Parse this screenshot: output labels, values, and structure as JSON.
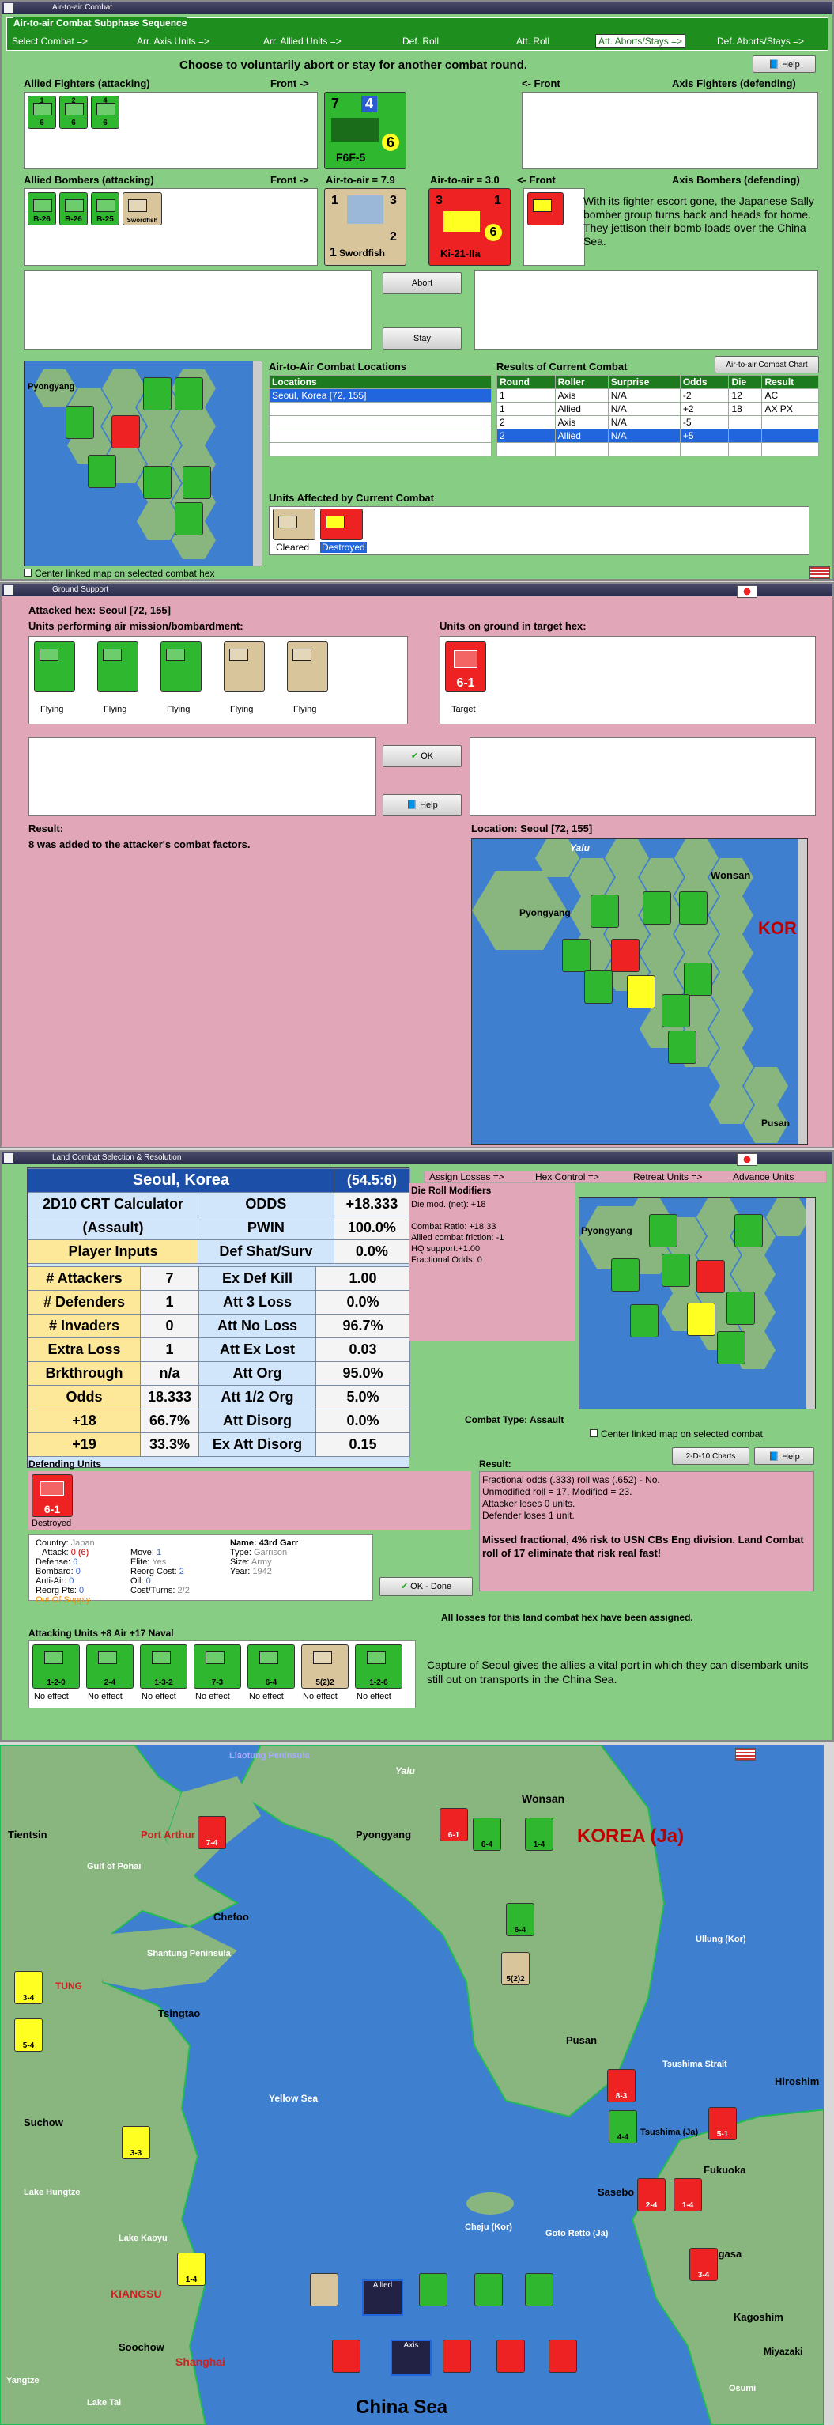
{
  "air": {
    "title": "Air-to-air Combat",
    "subphase": "Air-to-air Combat Subphase Sequence",
    "steps": [
      "Select Combat =>",
      "Arr. Axis Units =>",
      "Arr. Allied Units =>",
      "Def. Roll",
      "Att. Roll",
      "Att. Aborts/Stays =>",
      "Def. Aborts/Stays =>"
    ],
    "instruction": "Choose to voluntarily abort or stay for another combat round.",
    "help": "Help",
    "allied_fighters": "Allied Fighters (attacking)",
    "front": "Front ->",
    "front_back": "<- Front",
    "axis_fighters": "Axis Fighters (defending)",
    "allied_bombers": "Allied Bombers (attacking)",
    "axis_bombers": "Axis Bombers (defending)",
    "ata_allied": "Air-to-air = 7.9",
    "ata_axis": "Air-to-air = 3.0",
    "message": "With its fighter escort gone, the Japanese Sally bomber group turns back and heads for home.  They jettison their bomb loads over the China Sea.",
    "abort": "Abort",
    "stay": "Stay",
    "locations_title": "Air-to-Air Combat Locations",
    "locations_header": "Locations",
    "locations": [
      "Seoul, Korea [72, 155]"
    ],
    "results_title": "Results of Current Combat",
    "chart_btn": "Air-to-air Combat Chart",
    "results_headers": [
      "Round",
      "Roller",
      "Surprise",
      "Odds",
      "Die",
      "Result"
    ],
    "results": [
      [
        "1",
        "Axis",
        "N/A",
        "-2",
        "12",
        "AC"
      ],
      [
        "1",
        "Allied",
        "N/A",
        "+2",
        "18",
        "AX PX"
      ],
      [
        "2",
        "Axis",
        "N/A",
        "-5",
        "",
        ""
      ],
      [
        "2",
        "Allied",
        "N/A",
        "+5",
        "",
        ""
      ]
    ],
    "affected_title": "Units Affected by Current Combat",
    "affected": [
      "Cleared",
      "Destroyed"
    ],
    "center_map": "Center linked map on selected combat hex",
    "fighters": [
      {
        "n": "1",
        "v": "6"
      },
      {
        "n": "2",
        "v": "6"
      },
      {
        "n": "4",
        "v": "6"
      }
    ],
    "big_f": {
      "top": "7",
      "mid": "4",
      "bot": "6",
      "name": "F6F-5"
    },
    "bombers_lbl": [
      "B-26",
      "B-26",
      "B-25",
      "Swordfish"
    ],
    "big_b": {
      "a": "1",
      "b": "3",
      "name": "Swordfish",
      "c": "1",
      "d": "2"
    },
    "big_axis": {
      "a": "3",
      "b": "1",
      "v": "6",
      "name": "Ki-21-IIa"
    }
  },
  "ground": {
    "title": "Ground Support",
    "attacked": "Attacked hex: Seoul  [72, 155]",
    "performing": "Units performing air mission/bombardment:",
    "on_ground": "Units on ground in target hex:",
    "statuses": [
      "Flying",
      "Flying",
      "Flying",
      "Flying",
      "Flying"
    ],
    "target": "Target",
    "target_val": "6-1",
    "ok": "OK",
    "help": "Help",
    "result_lbl": "Result:",
    "result": "8 was added to the attacker's combat factors.",
    "location": "Location:  Seoul  [72, 155]",
    "map_labels": [
      "Yalu",
      "Wonsan",
      "Pyongyang",
      "KOR",
      "Pusan"
    ]
  },
  "land": {
    "title": "Land Combat Selection & Resolution",
    "steps": [
      "Assign Losses =>",
      "Hex Control =>",
      "Retreat Units =>",
      "Advance Units"
    ],
    "crt": {
      "location": "Seoul, Korea",
      "ratio": "(54.5:6)",
      "calc": "2D10 CRT Calculator",
      "assault": "(Assault)",
      "rows": [
        [
          "",
          "ODDS",
          "+18.333"
        ],
        [
          "",
          "PWIN",
          "100.0%"
        ],
        [
          "Player Inputs",
          "Def Shat/Surv",
          "0.0%"
        ],
        [
          "# Attackers",
          "7",
          "Ex Def Kill",
          "1.00"
        ],
        [
          "# Defenders",
          "1",
          "Att 3 Loss",
          "0.0%"
        ],
        [
          "# Invaders",
          "0",
          "Att No Loss",
          "96.7%"
        ],
        [
          "Extra Loss",
          "1",
          "Att Ex Lost",
          "0.03"
        ],
        [
          "Brkthrough",
          "n/a",
          "Att Org",
          "95.0%"
        ],
        [
          "Odds",
          "18.333",
          "Att 1/2 Org",
          "5.0%"
        ],
        [
          "+18",
          "66.7%",
          "Att Disorg",
          "0.0%"
        ],
        [
          "+19",
          "33.3%",
          "Ex Att Disorg",
          "0.15"
        ]
      ]
    },
    "drm_title": "Die Roll Modifiers",
    "drm": [
      "Die mod. (net): +18",
      "",
      "Combat Ratio: +18.33",
      "Allied combat friction: -1",
      "HQ support:+1.00",
      "Fractional Odds: 0"
    ],
    "combat_type": "Combat Type:  Assault",
    "center_map": "Center linked map on selected combat.",
    "charts_btn": "2-D-10 Charts",
    "help": "Help",
    "defending": "Defending Units",
    "destroyed": "Destroyed",
    "def_val": "6-1",
    "result_lbl": "Result:",
    "result_lines": [
      "Fractional odds (.333) roll was (.652)  - No.",
      "Unmodified roll = 17, Modified = 23.",
      "Attacker loses 0 units.",
      "Defender loses 1 unit."
    ],
    "result_bold": "Missed fractional, 4% risk to USN CBs Eng division. Land Combat roll of 17 eliminate that risk real fast!",
    "info": {
      "country_k": "Country:",
      "country": "Japan",
      "attack_k": "Attack:",
      "attack": "0 (6)",
      "defense_k": "Defense:",
      "defense": "6",
      "bombard_k": "Bombard:",
      "bombard": "0",
      "anti_k": "Anti-Air:",
      "anti": "0",
      "reorg_k": "Reorg Pts:",
      "reorg": "0",
      "supply": "Out Of Supply",
      "move_k": "Move:",
      "move": "1",
      "elite_k": "Elite:",
      "elite": "Yes",
      "rcost_k": "Reorg Cost:",
      "rcost": "2",
      "oil_k": "Oil:",
      "oil": "0",
      "ct_k": "Cost/Turns:",
      "ct": "2/2",
      "name_k": "Name:",
      "name": "43rd Garr",
      "type_k": "Type:",
      "type": "Garrison",
      "size_k": "Size:",
      "size": "Army",
      "year_k": "Year:",
      "year": "1942"
    },
    "ok_done": "OK - Done",
    "all_losses": "All losses for this land combat hex have been assigned.",
    "attacking": "Attacking Units +8 Air +17 Naval",
    "noeffect": [
      "No effect",
      "No effect",
      "No effect",
      "No effect",
      "No effect",
      "No effect",
      "No effect"
    ],
    "att_vals": [
      "1-2-0",
      "2-4",
      "1-3-2",
      "7-3",
      "6-4",
      "5(2)2",
      "1-2-6"
    ],
    "capture": "Capture of Seoul gives the allies a vital port in which they can disembark units still out on transports in the China Sea."
  },
  "map": {
    "labels": [
      "Liaotung Peninsula",
      "Yalu",
      "Wonsan",
      "Tientsin",
      "Port Arthur",
      "Pyongyang",
      "KOREA (Ja)",
      "Gulf of Pohai",
      "Chefoo",
      "Shantung Peninsula",
      "Ullung (Kor)",
      "TUNG",
      "Tsingtao",
      "Pusan",
      "Tsushima Strait",
      "Hiroshim",
      "Yellow Sea",
      "Suchow",
      "Lake Hungtze",
      "Fukuoka",
      "Tsushima (Ja)",
      "Sasebo",
      "Cheju (Kor)",
      "Goto Retto (Ja)",
      "Lake Kaoyu",
      "Nagasa",
      "KIANGSU",
      "Kagoshim",
      "Soochow",
      "Shanghai",
      "Miyazaki",
      "Yangtze",
      "Lake Tai",
      "Osumi",
      "China Sea"
    ],
    "allied_lbl": "Allied",
    "axis_lbl": "Axis",
    "unit_vals": [
      "7-4",
      "6-4",
      "1-4",
      "6-4",
      "5(2)2",
      "3-4",
      "5-4",
      "3-3",
      "1-4",
      "8-3",
      "5-1",
      "4-4",
      "2-4",
      "1-4",
      "3-4",
      "6-1"
    ]
  },
  "colors": {
    "green": "#2fb82f",
    "red": "#e22",
    "map_sea": "#3f7fd0",
    "map_land": "#89b67f",
    "crt_blue": "#1c4fa8"
  }
}
